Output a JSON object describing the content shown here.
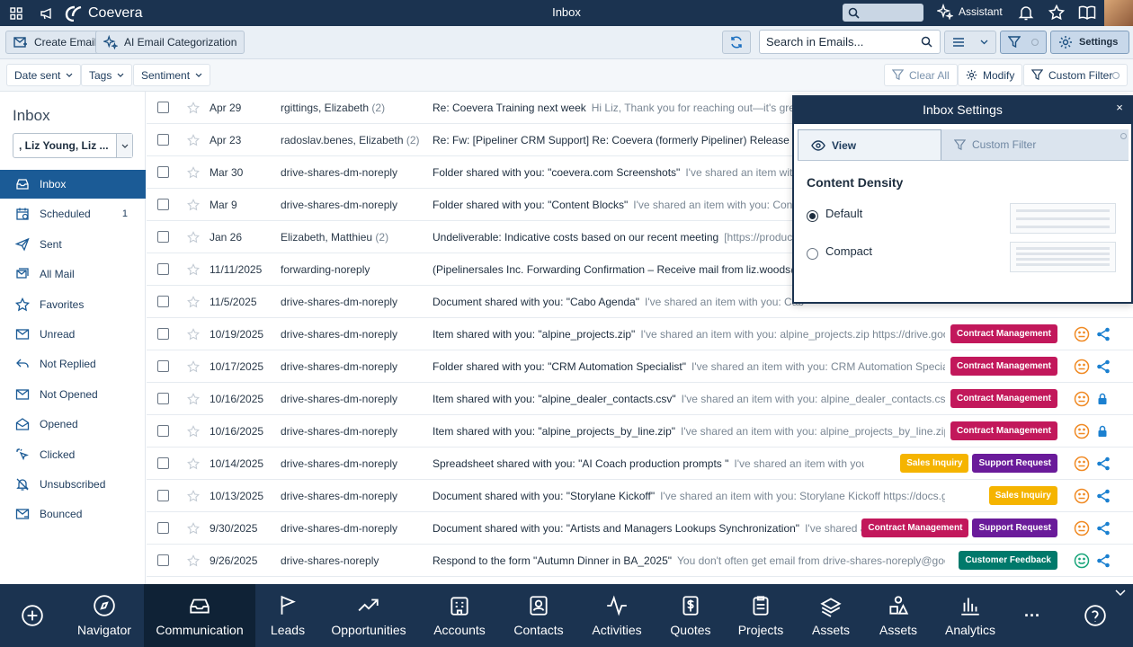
{
  "topbar": {
    "brand": "Coevera",
    "title": "Inbox",
    "assistant_label": "Assistant"
  },
  "toolbar": {
    "create_email": "Create Email",
    "ai_categorization": "AI Email Categorization",
    "search_placeholder": "Search in Emails...",
    "settings": "Settings"
  },
  "filters": {
    "date_sent": "Date sent",
    "tags": "Tags",
    "sentiment": "Sentiment",
    "clear_all": "Clear All",
    "modify": "Modify",
    "custom_filter": "Custom Filter"
  },
  "sidebar": {
    "title": "Inbox",
    "selected_user": ", Liz Young, Liz ...",
    "items": [
      {
        "label": "Inbox",
        "icon": "inbox-icon",
        "count": ""
      },
      {
        "label": "Scheduled",
        "icon": "calendar-icon",
        "count": "1"
      },
      {
        "label": "Sent",
        "icon": "send-icon",
        "count": ""
      },
      {
        "label": "All Mail",
        "icon": "all-mail-icon",
        "count": ""
      },
      {
        "label": "Favorites",
        "icon": "star-icon",
        "count": ""
      },
      {
        "label": "Unread",
        "icon": "unread-icon",
        "count": ""
      },
      {
        "label": "Not Replied",
        "icon": "reply-icon",
        "count": ""
      },
      {
        "label": "Not Opened",
        "icon": "envelope-icon",
        "count": ""
      },
      {
        "label": "Opened",
        "icon": "envelope-open-icon",
        "count": ""
      },
      {
        "label": "Clicked",
        "icon": "click-icon",
        "count": ""
      },
      {
        "label": "Unsubscribed",
        "icon": "bell-off-icon",
        "count": ""
      },
      {
        "label": "Bounced",
        "icon": "bounce-icon",
        "count": ""
      }
    ]
  },
  "emails": [
    {
      "date": "Apr 29",
      "from": "rgittings, Elizabeth",
      "count": "(2)",
      "subject": "Re: Coevera Training next week",
      "preview": "Hi Liz, Thank you for reaching out—it's great",
      "tags": [],
      "sentiment": "",
      "action": ""
    },
    {
      "date": "Apr 23",
      "from": "radoslav.benes, Elizabeth",
      "count": "(2)",
      "subject": "Re: Fw: [Pipeliner CRM Support] Re: Coevera (formerly Pipeliner) Release 6.0",
      "preview": "",
      "tags": [],
      "sentiment": "",
      "action": ""
    },
    {
      "date": "Mar 30",
      "from": "drive-shares-dm-noreply",
      "count": "",
      "subject": "Folder shared with you: \"coevera.com Screenshots\"",
      "preview": "I've shared an item with",
      "tags": [],
      "sentiment": "",
      "action": ""
    },
    {
      "date": "Mar 9",
      "from": "drive-shares-dm-noreply",
      "count": "",
      "subject": "Folder shared with you: \"Content Blocks\"",
      "preview": "I've shared an item with you: Conte",
      "tags": [],
      "sentiment": "",
      "action": ""
    },
    {
      "date": "Jan 26",
      "from": "Elizabeth, Matthieu",
      "count": "(2)",
      "subject": "Undeliverable: Indicative costs based on our recent meeting",
      "preview": "[https://product",
      "tags": [],
      "sentiment": "",
      "action": ""
    },
    {
      "date": "11/11/2025",
      "from": "forwarding-noreply",
      "count": "",
      "subject": "(Pipelinersales Inc. Forwarding Confirmation – Receive mail from liz.woods@",
      "preview": "",
      "tags": [],
      "sentiment": "",
      "action": ""
    },
    {
      "date": "11/5/2025",
      "from": "drive-shares-dm-noreply",
      "count": "",
      "subject": "Document shared with you: \"Cabo Agenda\"",
      "preview": "I've shared an item with you: Cab",
      "tags": [],
      "sentiment": "",
      "action": ""
    },
    {
      "date": "10/19/2025",
      "from": "drive-shares-dm-noreply",
      "count": "",
      "subject": "Item shared with you: \"alpine_projects.zip\"",
      "preview": "I've shared an item with you: alpine_projects.zip https://drive.goo...",
      "tags": [
        "Contract Management"
      ],
      "sentiment": "neutral",
      "action": "share"
    },
    {
      "date": "10/17/2025",
      "from": "drive-shares-dm-noreply",
      "count": "",
      "subject": "Folder shared with you: \"CRM Automation Specialist\"",
      "preview": "I've shared an item with you: CRM Automation Special...",
      "tags": [
        "Contract Management"
      ],
      "sentiment": "neutral",
      "action": "share"
    },
    {
      "date": "10/16/2025",
      "from": "drive-shares-dm-noreply",
      "count": "",
      "subject": "Item shared with you: \"alpine_dealer_contacts.csv\"",
      "preview": "I've shared an item with you: alpine_dealer_contacts.csv ...",
      "tags": [
        "Contract Management"
      ],
      "sentiment": "neutral",
      "action": "lock"
    },
    {
      "date": "10/16/2025",
      "from": "drive-shares-dm-noreply",
      "count": "",
      "subject": "Item shared with you: \"alpine_projects_by_line.zip\"",
      "preview": "I've shared an item with you: alpine_projects_by_line.zip ...",
      "tags": [
        "Contract Management"
      ],
      "sentiment": "neutral",
      "action": "lock"
    },
    {
      "date": "10/14/2025",
      "from": "drive-shares-dm-noreply",
      "count": "",
      "subject": "Spreadsheet shared with you: \"AI Coach production prompts \"",
      "preview": "I've shared an item with you: AI Coa...",
      "tags": [
        "Sales Inquiry",
        "Support Request"
      ],
      "sentiment": "neutral",
      "action": "share"
    },
    {
      "date": "10/13/2025",
      "from": "drive-shares-dm-noreply",
      "count": "",
      "subject": "Document shared with you: \"Storylane Kickoff\"",
      "preview": "I've shared an item with you: Storylane Kickoff https://docs.google.c...",
      "tags": [
        "Sales Inquiry"
      ],
      "sentiment": "neutral",
      "action": "share"
    },
    {
      "date": "9/30/2025",
      "from": "drive-shares-dm-noreply",
      "count": "",
      "subject": "Document shared with you: \"Artists and Managers Lookups Synchronization\"",
      "preview": "I've shared a...",
      "tags": [
        "Contract Management",
        "Support Request"
      ],
      "sentiment": "neutral",
      "action": "share"
    },
    {
      "date": "9/26/2025",
      "from": "drive-shares-noreply",
      "count": "",
      "subject": "Respond to the form \"Autumn Dinner in BA_2025\"",
      "preview": "You don't often get email from drive-shares-noreply@googl...",
      "tags": [
        "Customer Feedback"
      ],
      "sentiment": "positive",
      "action": "share"
    }
  ],
  "tag_colors": {
    "Contract Management": "#c2185b",
    "Sales Inquiry": "#f5b400",
    "Support Request": "#6a1b9a",
    "Customer Feedback": "#00796b"
  },
  "settings_panel": {
    "title": "Inbox Settings",
    "close": "×",
    "tab_view": "View",
    "tab_custom_filter": "Custom Filter",
    "section": "Content Density",
    "opt_default": "Default",
    "opt_compact": "Compact"
  },
  "bottom_nav": [
    {
      "label": "",
      "icon": "plus-circle-icon"
    },
    {
      "label": "Navigator",
      "icon": "compass-icon"
    },
    {
      "label": "Communication",
      "icon": "inbox-tray-icon"
    },
    {
      "label": "Leads",
      "icon": "flag-icon"
    },
    {
      "label": "Opportunities",
      "icon": "trend-up-icon"
    },
    {
      "label": "Accounts",
      "icon": "building-icon"
    },
    {
      "label": "Contacts",
      "icon": "contact-card-icon"
    },
    {
      "label": "Activities",
      "icon": "pulse-icon"
    },
    {
      "label": "Quotes",
      "icon": "dollar-doc-icon"
    },
    {
      "label": "Projects",
      "icon": "clipboard-icon"
    },
    {
      "label": "Assets",
      "icon": "stack-icon"
    },
    {
      "label": "Assets",
      "icon": "shapes-icon"
    },
    {
      "label": "Analytics",
      "icon": "bar-chart-icon"
    },
    {
      "label": "···",
      "icon": "more-icon"
    },
    {
      "label": "",
      "icon": "help-icon"
    }
  ]
}
